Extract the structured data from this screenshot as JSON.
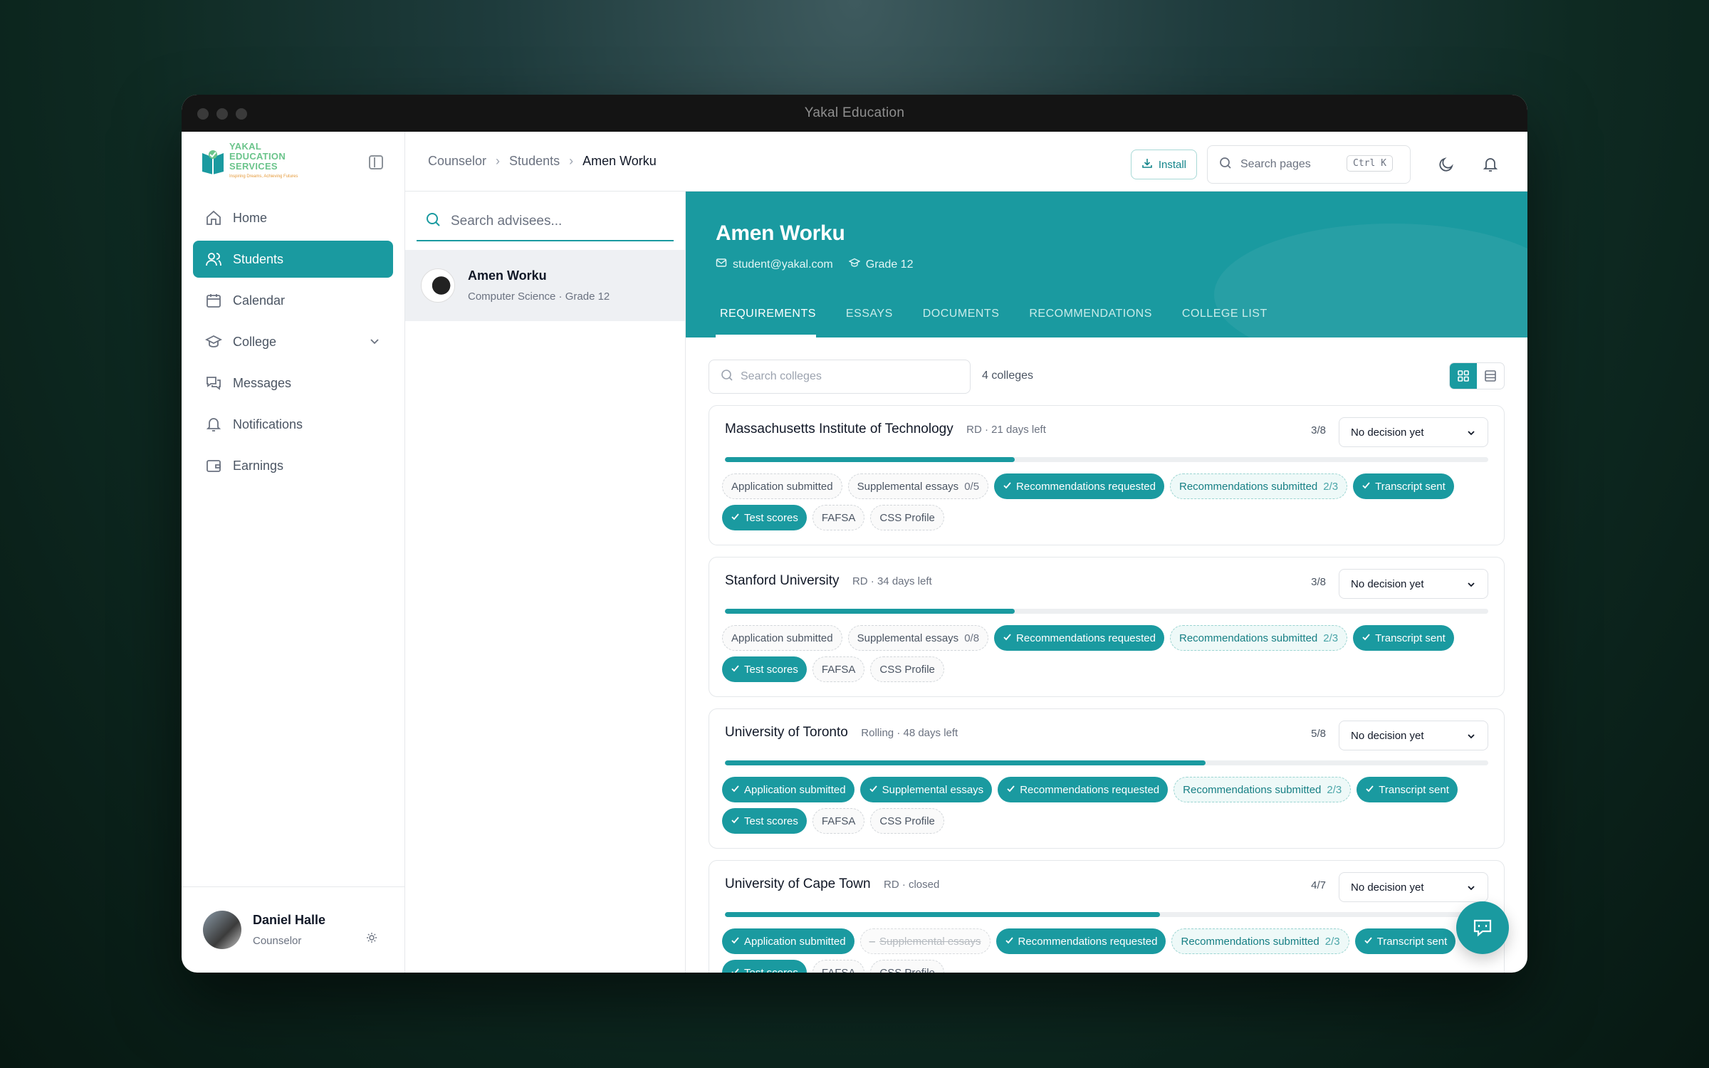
{
  "window": {
    "title": "Yakal Education"
  },
  "brand": {
    "name": "YAKAL EDUCATION SERVICES",
    "tagline": "Inspiring Dreams, Achieving Futures",
    "accent": "#1a9aa0"
  },
  "sidebar": {
    "items": [
      {
        "label": "Home",
        "icon": "home-icon"
      },
      {
        "label": "Students",
        "icon": "users-icon",
        "active": true
      },
      {
        "label": "Calendar",
        "icon": "calendar-icon"
      },
      {
        "label": "College",
        "icon": "graduation-cap-icon"
      },
      {
        "label": "Messages",
        "icon": "messages-icon"
      },
      {
        "label": "Notifications",
        "icon": "bell-icon"
      },
      {
        "label": "Earnings",
        "icon": "wallet-icon"
      }
    ],
    "profile": {
      "name": "Daniel Halle",
      "role": "Counselor"
    }
  },
  "breadcrumb": {
    "items": [
      "Counselor",
      "Students"
    ],
    "current": "Amen Worku"
  },
  "topbar": {
    "install_label": "Install",
    "search_placeholder": "Search pages",
    "shortcut": "Ctrl K"
  },
  "advisees": {
    "search_placeholder": "Search advisees...",
    "list": [
      {
        "name": "Amen Worku",
        "subtitle": "Computer Science · Grade 12"
      }
    ]
  },
  "student": {
    "name": "Amen Worku",
    "email": "student@yakal.com",
    "grade": "Grade 12",
    "tabs": [
      "REQUIREMENTS",
      "ESSAYS",
      "DOCUMENTS",
      "RECOMMENDATIONS",
      "COLLEGE LIST"
    ],
    "active_tab": "REQUIREMENTS"
  },
  "colleges_toolbar": {
    "search_placeholder": "Search colleges",
    "count_label": "4 colleges"
  },
  "colleges": [
    {
      "name": "Massachusetts Institute of Technology",
      "meta": "RD · 21 days left",
      "ratio": "3/8",
      "progress": 0.38,
      "decision": "No decision yet",
      "chips": [
        {
          "label": "Application submitted",
          "state": "todo"
        },
        {
          "label": "Supplemental essays",
          "count": "0/5",
          "state": "todo"
        },
        {
          "label": "Recommendations requested",
          "state": "done"
        },
        {
          "label": "Recommendations submitted",
          "count": "2/3",
          "state": "partial"
        },
        {
          "label": "Transcript sent",
          "state": "done"
        },
        {
          "label": "Test scores",
          "state": "done"
        },
        {
          "label": "FAFSA",
          "state": "todo"
        },
        {
          "label": "CSS Profile",
          "state": "todo"
        }
      ]
    },
    {
      "name": "Stanford University",
      "meta": "RD · 34 days left",
      "ratio": "3/8",
      "progress": 0.38,
      "decision": "No decision yet",
      "chips": [
        {
          "label": "Application submitted",
          "state": "todo"
        },
        {
          "label": "Supplemental essays",
          "count": "0/8",
          "state": "todo"
        },
        {
          "label": "Recommendations requested",
          "state": "done"
        },
        {
          "label": "Recommendations submitted",
          "count": "2/3",
          "state": "partial"
        },
        {
          "label": "Transcript sent",
          "state": "done"
        },
        {
          "label": "Test scores",
          "state": "done"
        },
        {
          "label": "FAFSA",
          "state": "todo"
        },
        {
          "label": "CSS Profile",
          "state": "todo"
        }
      ]
    },
    {
      "name": "University of Toronto",
      "meta": "Rolling · 48 days left",
      "ratio": "5/8",
      "progress": 0.63,
      "decision": "No decision yet",
      "chips": [
        {
          "label": "Application submitted",
          "state": "done"
        },
        {
          "label": "Supplemental essays",
          "state": "done"
        },
        {
          "label": "Recommendations requested",
          "state": "done"
        },
        {
          "label": "Recommendations submitted",
          "count": "2/3",
          "state": "partial"
        },
        {
          "label": "Transcript sent",
          "state": "done"
        },
        {
          "label": "Test scores",
          "state": "done"
        },
        {
          "label": "FAFSA",
          "state": "todo"
        },
        {
          "label": "CSS Profile",
          "state": "todo"
        }
      ]
    },
    {
      "name": "University of Cape Town",
      "meta": "RD · closed",
      "ratio": "4/7",
      "progress": 0.57,
      "decision": "No decision yet",
      "chips": [
        {
          "label": "Application submitted",
          "state": "done"
        },
        {
          "label": "Supplemental essays",
          "state": "na"
        },
        {
          "label": "Recommendations requested",
          "state": "done"
        },
        {
          "label": "Recommendations submitted",
          "count": "2/3",
          "state": "partial"
        },
        {
          "label": "Transcript sent",
          "state": "done"
        },
        {
          "label": "Test scores",
          "state": "done"
        },
        {
          "label": "FAFSA",
          "state": "todo"
        },
        {
          "label": "CSS Profile",
          "state": "todo"
        }
      ]
    }
  ]
}
